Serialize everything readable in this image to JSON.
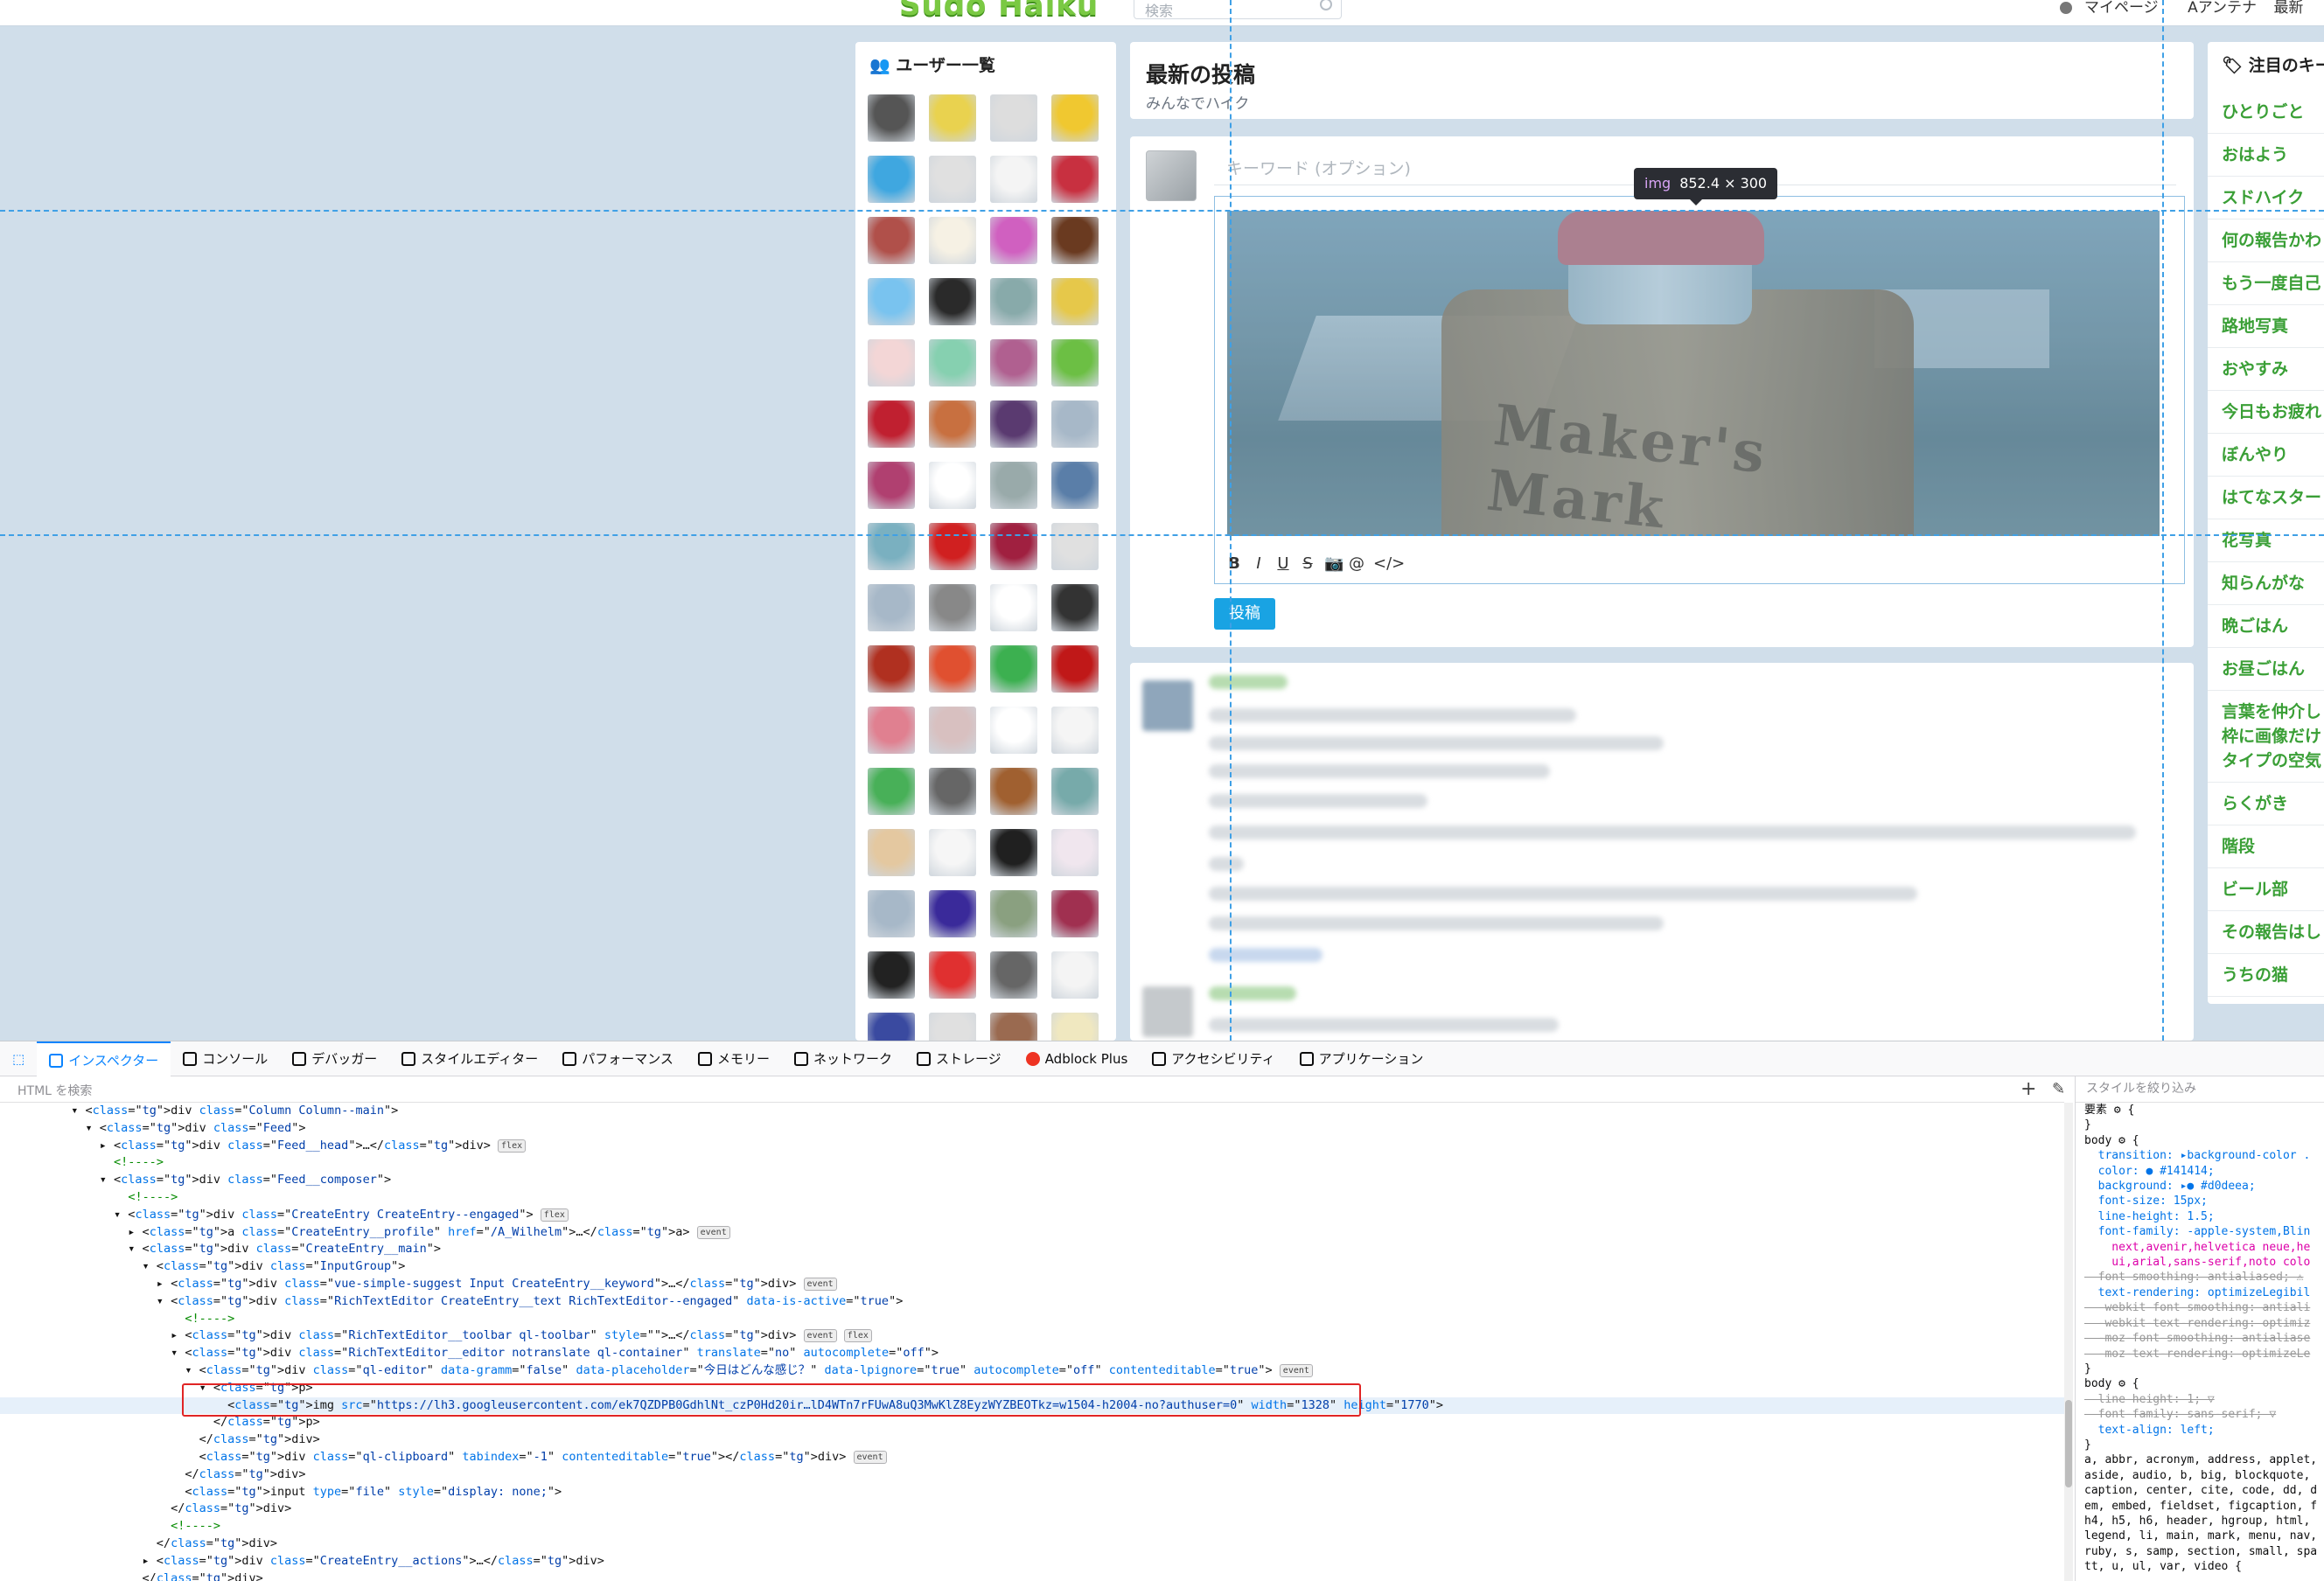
{
  "site": {
    "logo": "Sudo Haiku",
    "search_placeholder": "検索",
    "nav": [
      "マイページ",
      "Aアンテナ",
      "最新"
    ]
  },
  "users_panel": {
    "title": "ユーザー一覧",
    "avatar_count": 64
  },
  "feed": {
    "title": "最新の投稿",
    "subtitle": "みんなでハイク"
  },
  "composer": {
    "keyword_placeholder": "キーワード (オプション)",
    "post_button": "投稿",
    "toolbar": [
      "B",
      "I",
      "U",
      "S",
      "camera-icon",
      "mention-icon",
      "code-icon"
    ],
    "image_label": "Maker's Mark"
  },
  "tooltip": {
    "tag": "img",
    "size": "852.4 × 300"
  },
  "tags_panel": {
    "title": "注目のキー",
    "items": [
      "ひとりごと",
      "おはよう",
      "スドハイク",
      "何の報告かわ",
      "もう一度自己",
      "路地写真",
      "おやすみ",
      "今日もお疲れ",
      "ぼんやり",
      "はてなスター",
      "花写真",
      "知らんがな",
      "晩ごはん",
      "お昼ごはん",
      "言葉を仲介し\n枠に画像だけ\nタイプの空気",
      "らくがき",
      "階段",
      "ビール部",
      "その報告はし",
      "うちの猫"
    ]
  },
  "devtools": {
    "tabs": [
      "インスペクター",
      "コンソール",
      "デバッガー",
      "スタイルエディター",
      "パフォーマンス",
      "メモリー",
      "ネットワーク",
      "ストレージ",
      "Adblock Plus",
      "アクセシビリティ",
      "アプリケーション"
    ],
    "html_search_placeholder": "HTML を検索",
    "styles_filter_placeholder": "スタイルを絞り込み",
    "dom_lines": [
      {
        "indent": 4,
        "tw": "▾",
        "html": "<div class=\"Column Column--main\">"
      },
      {
        "indent": 5,
        "tw": "▾",
        "html": "<div class=\"Feed\">"
      },
      {
        "indent": 6,
        "tw": "▸",
        "html": "<div class=\"Feed__head\">…</div>",
        "badge": "flex"
      },
      {
        "indent": 6,
        "tw": "",
        "html": "<!---->",
        "comment": true
      },
      {
        "indent": 6,
        "tw": "▾",
        "html": "<div class=\"Feed__composer\">"
      },
      {
        "indent": 7,
        "tw": "",
        "html": "<!---->",
        "comment": true
      },
      {
        "indent": 7,
        "tw": "▾",
        "html": "<div class=\"CreateEntry CreateEntry--engaged\">",
        "badge": "flex"
      },
      {
        "indent": 8,
        "tw": "▸",
        "html": "<a class=\"CreateEntry__profile\" href=\"/A_Wilhelm\">…</a>",
        "badge": "event"
      },
      {
        "indent": 8,
        "tw": "▾",
        "html": "<div class=\"CreateEntry__main\">"
      },
      {
        "indent": 9,
        "tw": "▾",
        "html": "<div class=\"InputGroup\">"
      },
      {
        "indent": 10,
        "tw": "▸",
        "html": "<div class=\"vue-simple-suggest Input CreateEntry__keyword\">…</div>",
        "badge": "event"
      },
      {
        "indent": 10,
        "tw": "▾",
        "html": "<div class=\"RichTextEditor CreateEntry__text RichTextEditor--engaged\" data-is-active=\"true\">"
      },
      {
        "indent": 11,
        "tw": "",
        "html": "<!---->",
        "comment": true
      },
      {
        "indent": 11,
        "tw": "▸",
        "html": "<div class=\"RichTextEditor__toolbar ql-toolbar\" style=\"\">…</div>",
        "badge": "event flex"
      },
      {
        "indent": 11,
        "tw": "▾",
        "html": "<div class=\"RichTextEditor__editor notranslate ql-container\" translate=\"no\" autocomplete=\"off\">"
      },
      {
        "indent": 12,
        "tw": "▾",
        "html": "<div class=\"ql-editor\" data-gramm=\"false\" data-placeholder=\"今日はどんな感じ？\" data-lpignore=\"true\" autocomplete=\"off\" contenteditable=\"true\">",
        "badge": "event"
      },
      {
        "indent": 13,
        "tw": "▾",
        "html": "<p>"
      },
      {
        "indent": 14,
        "tw": "",
        "html": "<img src=\"https://lh3.googleusercontent.com/ek7QZDPB0GdhlNt_czP0Hd20ir…lD4WTn7rFUwA8uQ3MwKlZ8EyzWYZBEOTkz=w1504-h2004-no?authuser=0\" width=\"1328\" height=\"1770\">",
        "highlight": true
      },
      {
        "indent": 13,
        "tw": "",
        "html": "</p>"
      },
      {
        "indent": 12,
        "tw": "",
        "html": "</div>"
      },
      {
        "indent": 12,
        "tw": "",
        "html": "<div class=\"ql-clipboard\" tabindex=\"-1\" contenteditable=\"true\"></div>",
        "badge": "event"
      },
      {
        "indent": 11,
        "tw": "",
        "html": "</div>"
      },
      {
        "indent": 11,
        "tw": "",
        "html": "<input type=\"file\" style=\"display: none;\">"
      },
      {
        "indent": 10,
        "tw": "",
        "html": "</div>"
      },
      {
        "indent": 10,
        "tw": "",
        "html": "<!---->",
        "comment": true
      },
      {
        "indent": 9,
        "tw": "",
        "html": "</div>"
      },
      {
        "indent": 9,
        "tw": "▸",
        "html": "<div class=\"CreateEntry__actions\">…</div>"
      },
      {
        "indent": 8,
        "tw": "",
        "html": "</div>"
      }
    ],
    "rules_lines": [
      {
        "t": "要素 ⚙ {",
        "c": "sel"
      },
      {
        "t": "}",
        "c": "sel"
      },
      {
        "t": "body ⚙ {",
        "c": "sel"
      },
      {
        "t": "  transition: ▸background-color .",
        "c": "pv"
      },
      {
        "t": "  color: ● #141414;",
        "c": "pv"
      },
      {
        "t": "  background: ▸● #d0deea;",
        "c": "pv"
      },
      {
        "t": "  font-size: 15px;",
        "c": "pv"
      },
      {
        "t": "  line-height: 1.5;",
        "c": "pv"
      },
      {
        "t": "  font-family: -apple-system,Blin",
        "c": "pv"
      },
      {
        "t": "    next,avenir,helvetica neue,he",
        "c": "pn"
      },
      {
        "t": "    ui,arial,sans-serif,noto colo",
        "c": "pn"
      },
      {
        "t": "  font-smoothing: antialiased; ⚠",
        "c": "st"
      },
      {
        "t": "  text-rendering: optimizeLegibil",
        "c": "pv"
      },
      {
        "t": "  -webkit-font-smoothing: antiali",
        "c": "st"
      },
      {
        "t": "  -webkit-text-rendering: optimiz",
        "c": "st"
      },
      {
        "t": "  -moz-font-smoothing: antialiase",
        "c": "st"
      },
      {
        "t": "  -moz-text-rendering: optimizeLe",
        "c": "st"
      },
      {
        "t": "}",
        "c": "sel"
      },
      {
        "t": "body ⚙ {",
        "c": "sel"
      },
      {
        "t": "  line-height: 1; ▽",
        "c": "st"
      },
      {
        "t": "  font-family: sans-serif; ▽",
        "c": "st"
      },
      {
        "t": "  text-align: left;",
        "c": "pv"
      },
      {
        "t": "}",
        "c": "sel"
      },
      {
        "t": "a, abbr, acronym, address, applet,",
        "c": "sel"
      },
      {
        "t": "aside, audio, b, big, blockquote,",
        "c": "sel"
      },
      {
        "t": "caption, center, cite, code, dd, d",
        "c": "sel"
      },
      {
        "t": "em, embed, fieldset, figcaption, f",
        "c": "sel"
      },
      {
        "t": "h4, h5, h6, header, hgroup, html,",
        "c": "sel"
      },
      {
        "t": "legend, li, main, mark, menu, nav,",
        "c": "sel"
      },
      {
        "t": "ruby, s, samp, section, small, spa",
        "c": "sel"
      },
      {
        "t": "tt, u, ul, var, video {",
        "c": "sel"
      }
    ]
  }
}
